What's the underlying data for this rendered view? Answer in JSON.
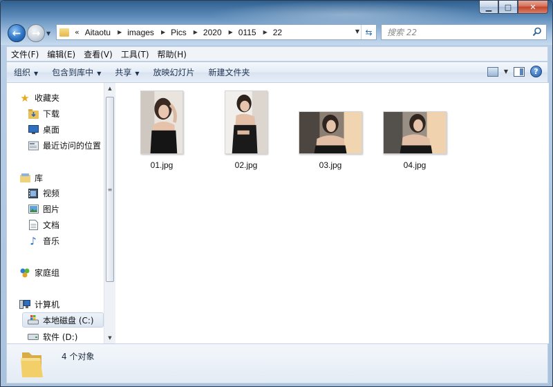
{
  "window": {
    "caption_buttons": {
      "minimize": "▁",
      "maximize": "□",
      "close": "✕"
    }
  },
  "address_bar": {
    "overflow": "«",
    "breadcrumbs": [
      "Aitaotu",
      "images",
      "Pics",
      "2020",
      "0115",
      "22"
    ]
  },
  "search": {
    "placeholder": "搜索 22"
  },
  "menu": {
    "items": [
      "文件(F)",
      "编辑(E)",
      "查看(V)",
      "工具(T)",
      "帮助(H)"
    ]
  },
  "commands": {
    "organize": "组织",
    "include_library": "包含到库中",
    "share": "共享",
    "slideshow": "放映幻灯片",
    "new_folder": "新建文件夹",
    "help": "?"
  },
  "nav": {
    "favorites": "收藏夹",
    "downloads": "下载",
    "desktop": "桌面",
    "recent": "最近访问的位置",
    "libraries": "库",
    "videos": "视频",
    "pictures": "图片",
    "documents": "文档",
    "music": "音乐",
    "homegroup": "家庭组",
    "computer": "计算机",
    "local_disk": "本地磁盘 (C:)",
    "software": "软件 (D:)"
  },
  "files": [
    {
      "name": "01.jpg"
    },
    {
      "name": "02.jpg"
    },
    {
      "name": "03.jpg"
    },
    {
      "name": "04.jpg"
    }
  ],
  "status": {
    "text": "4 个对象"
  },
  "colors": {
    "accent": "#2c74c5",
    "selection": "#dbe5f1"
  }
}
